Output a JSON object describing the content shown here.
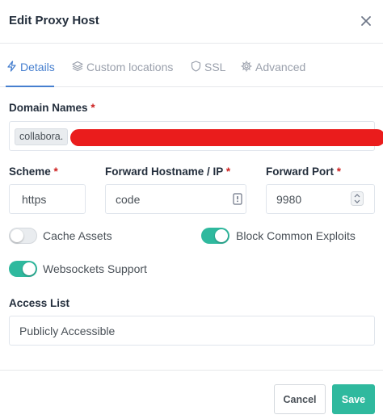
{
  "modal": {
    "title": "Edit Proxy Host"
  },
  "tabs": [
    {
      "label": "Details",
      "icon": "bolt-icon",
      "active": true
    },
    {
      "label": "Custom locations",
      "icon": "layers-icon",
      "active": false
    },
    {
      "label": "SSL",
      "icon": "shield-icon",
      "active": false
    },
    {
      "label": "Advanced",
      "icon": "gear-icon",
      "active": false
    }
  ],
  "domain": {
    "label": "Domain Names",
    "required_mark": "*",
    "chip_value": "collabora."
  },
  "scheme": {
    "label": "Scheme",
    "required_mark": "*",
    "value": "https"
  },
  "forward_host": {
    "label": "Forward Hostname / IP",
    "required_mark": "*",
    "value": "code"
  },
  "forward_port": {
    "label": "Forward Port",
    "required_mark": "*",
    "value": "9980"
  },
  "toggles": {
    "cache_assets": {
      "label": "Cache Assets",
      "enabled": false
    },
    "block_exploits": {
      "label": "Block Common Exploits",
      "enabled": true
    },
    "websockets": {
      "label": "Websockets Support",
      "enabled": true
    }
  },
  "access_list": {
    "label": "Access List",
    "value": "Publicly Accessible"
  },
  "footer": {
    "cancel_label": "Cancel",
    "save_label": "Save"
  },
  "colors": {
    "accent_blue": "#467fcf",
    "toggle_on": "#2fb99e",
    "save_button": "#2fb99e",
    "required": "#cd201f",
    "redaction": "#ea1c1c"
  }
}
